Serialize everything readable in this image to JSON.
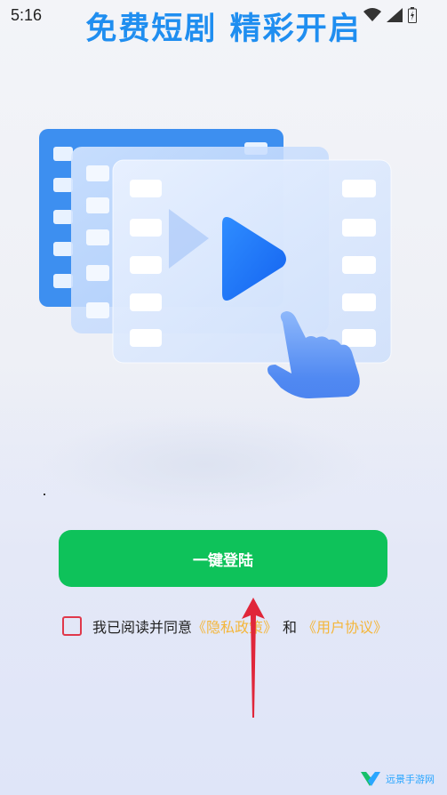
{
  "status_bar": {
    "time": "5:16"
  },
  "header": {
    "title": "免费短剧 精彩开启"
  },
  "login": {
    "button_label": "一键登陆"
  },
  "agreement": {
    "prefix": "我已阅读并同意",
    "privacy_link": "《隐私政策》",
    "and": "和",
    "user_link": "《用户协议》",
    "checked": false
  },
  "watermark": {
    "text": "远景手游网"
  },
  "colors": {
    "title_blue": "#1f8ef0",
    "button_green": "#0ec25a",
    "link_yellow": "#f4b63a",
    "checkbox_red": "#e0384b",
    "arrow_red": "#e0263a"
  }
}
